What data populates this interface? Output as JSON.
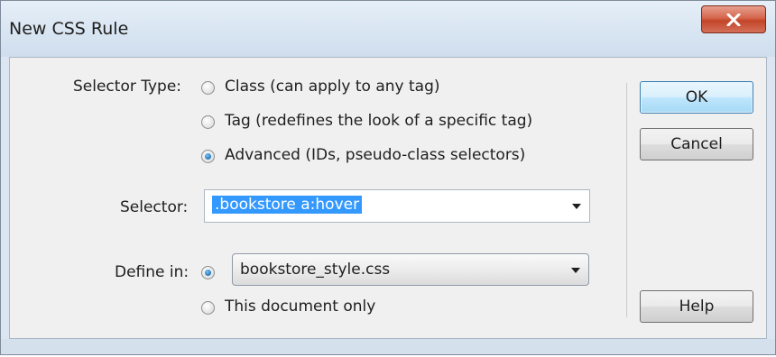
{
  "window": {
    "title": "New CSS Rule",
    "close_icon": "close-x-icon"
  },
  "selector_type": {
    "label": "Selector Type:",
    "options": [
      {
        "label": "Class (can apply to any tag)",
        "checked": false
      },
      {
        "label": "Tag (redefines the look of a specific tag)",
        "checked": false
      },
      {
        "label": "Advanced (IDs, pseudo-class selectors)",
        "checked": true
      }
    ]
  },
  "selector": {
    "label": "Selector:",
    "value": ".bookstore  a:hover"
  },
  "define_in": {
    "label": "Define in:",
    "file_option_checked": true,
    "file_value": "bookstore_style.css",
    "document_only_label": "This document only",
    "document_only_checked": false
  },
  "buttons": {
    "ok": "OK",
    "cancel": "Cancel",
    "help": "Help"
  },
  "colors": {
    "selection_highlight": "#3399ff",
    "close_button": "#c94b30",
    "default_button_border": "#3c7fb1"
  }
}
